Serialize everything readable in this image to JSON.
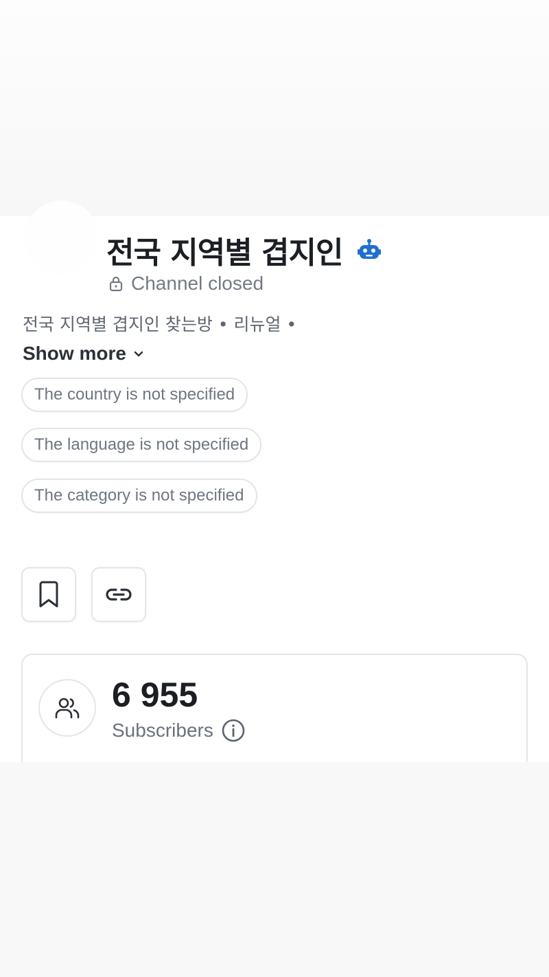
{
  "channel": {
    "title": "전국 지역별 겹지인",
    "status": "Channel closed",
    "description": "전국 지역별 겹지인 찾는방 • 리뉴얼 •",
    "show_more_label": "Show more"
  },
  "chips": {
    "country": "The country is not specified",
    "language": "The language is not specified",
    "category": "The category is not specified"
  },
  "stats": {
    "subscribers_count": "6 955",
    "subscribers_label": "Subscribers"
  },
  "icons": {
    "bot": "robot-icon",
    "lock": "lock-icon",
    "chevron": "chevron-down-icon",
    "bookmark": "bookmark-icon",
    "link": "link-icon",
    "users": "users-icon",
    "info": "info-icon"
  },
  "colors": {
    "accent": "#1f6fd1",
    "title_text": "#1b1f23",
    "muted_text": "#737a86",
    "border": "#e3e5e8"
  }
}
